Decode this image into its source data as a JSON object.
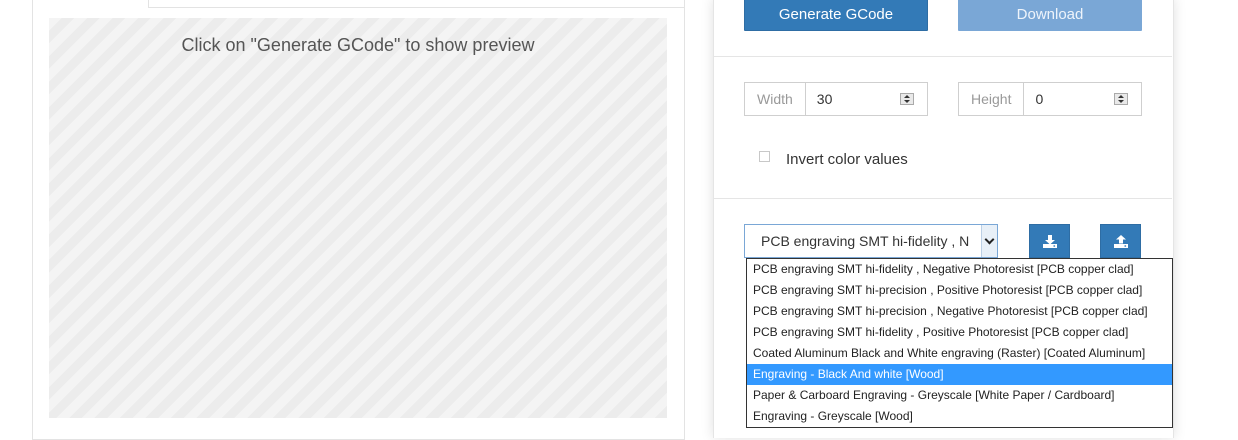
{
  "preview": {
    "message": "Click on \"Generate GCode\" to show preview"
  },
  "actions": {
    "generate_label": "Generate GCode",
    "download_label": "Download"
  },
  "dimensions": {
    "width_label": "Width",
    "width_value": "30",
    "height_label": "Height",
    "height_value": "0"
  },
  "options": {
    "invert_label": "Invert color values",
    "invert_checked": false
  },
  "preset": {
    "selected_text": "PCB engraving SMT hi-fidelity , N",
    "download_icon": "download-icon",
    "upload_icon": "upload-icon",
    "items": [
      "PCB engraving SMT hi-fidelity , Negative Photoresist [PCB copper clad]",
      "PCB engraving SMT hi-precision , Positive Photoresist [PCB copper clad]",
      "PCB engraving SMT hi-precision , Negative Photoresist [PCB copper clad]",
      "PCB engraving SMT hi-fidelity , Positive Photoresist [PCB copper clad]",
      "Coated Aluminum Black and White engraving (Raster) [Coated Aluminum]",
      "Engraving - Black And white [Wood]",
      "Paper & Carboard Engraving - Greyscale [White Paper / Cardboard]",
      "Engraving - Greyscale [Wood]"
    ],
    "highlighted_index": 5
  },
  "colors": {
    "primary": "#337ab7",
    "primary_disabled": "#7aa7d6",
    "highlight": "#3399ff"
  }
}
